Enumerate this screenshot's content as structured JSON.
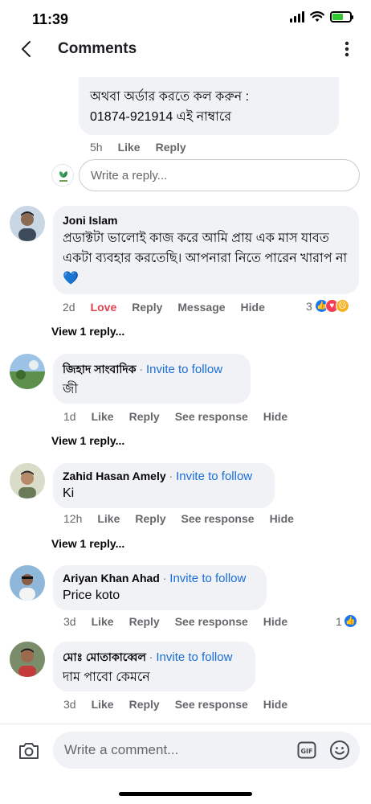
{
  "status_bar": {
    "time": "11:39"
  },
  "header": {
    "title": "Comments"
  },
  "prev_reply": {
    "line1": "অথবা অর্ডার করতে কল করুন :",
    "line2": "01874-921914 এই নাম্বারে",
    "time": "5h",
    "like": "Like",
    "reply": "Reply"
  },
  "reply_box": {
    "placeholder": "Write a reply..."
  },
  "comments": [
    {
      "author": "Joni Islam",
      "text": "প্রডাক্টটা ভালোই কাজ করে আমি প্রায় এক মাস যাবত একটা ব্যবহার করতেছি। আপনারা নিতে পারেন খারাপ না 💙",
      "time": "2d",
      "like": "Love",
      "reply": "Reply",
      "message": "Message",
      "hide": "Hide",
      "reaction_count": "3",
      "view_replies": "View 1 reply..."
    },
    {
      "author": "জিহাদ সাংবাদিক",
      "follow": "Invite to follow",
      "text": "জী",
      "time": "1d",
      "like": "Like",
      "reply": "Reply",
      "see_response": "See response",
      "hide": "Hide",
      "view_replies": "View 1 reply..."
    },
    {
      "author": "Zahid Hasan Amely",
      "follow": "Invite to follow",
      "text": "Ki",
      "time": "12h",
      "like": "Like",
      "reply": "Reply",
      "see_response": "See response",
      "hide": "Hide",
      "view_replies": "View 1 reply..."
    },
    {
      "author": "Ariyan Khan Ahad",
      "follow": "Invite to follow",
      "text": "Price koto",
      "time": "3d",
      "like": "Like",
      "reply": "Reply",
      "see_response": "See response",
      "hide": "Hide",
      "reaction_count": "1"
    },
    {
      "author": "মোঃ মোতাকাব্বেল",
      "follow": "Invite to follow",
      "text": "দাম পাবো কেমনে",
      "time": "3d",
      "like": "Like",
      "reply": "Reply",
      "see_response": "See response",
      "hide": "Hide"
    }
  ],
  "composer": {
    "placeholder": "Write a comment..."
  },
  "colors": {
    "accent": "#1a6ed8",
    "love": "#e0424e",
    "bubble": "#f0f2f5",
    "meta": "#65676b"
  }
}
